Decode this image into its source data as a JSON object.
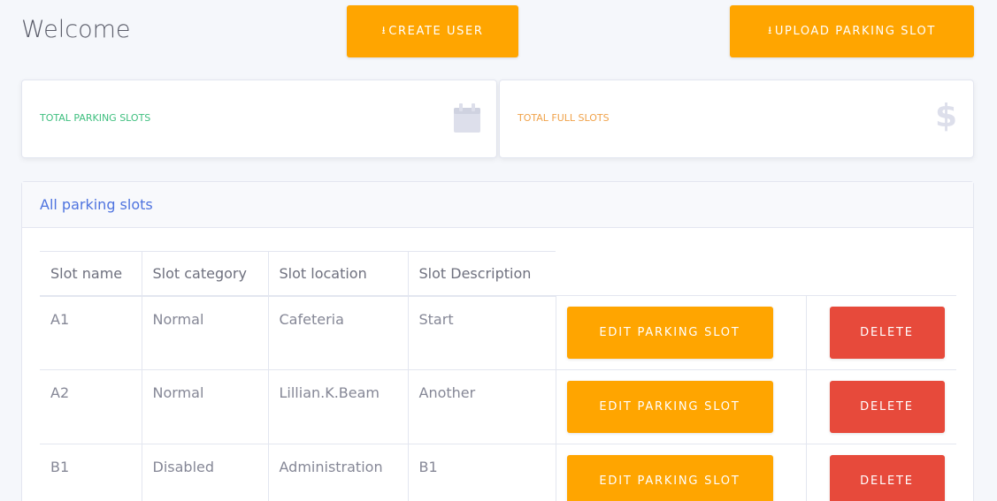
{
  "header": {
    "title": "Welcome",
    "create_user_label": "CREATE USER",
    "upload_slot_label": "UPLOAD PARKING SLOT",
    "download_icon": "download-icon"
  },
  "cards": [
    {
      "label": "TOTAL PARKING SLOTS",
      "icon": "calendar-icon",
      "color": "#3fbf7f"
    },
    {
      "label": "TOTAL FULL SLOTS",
      "icon": "dollar-icon",
      "glyph": "$",
      "color": "#f0a24a"
    }
  ],
  "panel": {
    "title": "All parking slots",
    "columns": [
      "Slot name",
      "Slot category",
      "Slot location",
      "Slot Description"
    ],
    "rows": [
      {
        "name": "A1",
        "category": "Normal",
        "location": "Cafeteria",
        "description": "Start",
        "edit_label": "EDIT PARKING SLOT",
        "delete_label": "DELETE"
      },
      {
        "name": "A2",
        "category": "Normal",
        "location": "Lillian.K.Beam",
        "description": "Another",
        "edit_label": "EDIT PARKING SLOT",
        "delete_label": "DELETE"
      },
      {
        "name": "B1",
        "category": "Disabled",
        "location": "Administration",
        "description": "B1",
        "edit_label": "EDIT PARKING SLOT",
        "delete_label": "DELETE"
      }
    ]
  },
  "colors": {
    "accent_orange": "#ffa500",
    "danger_red": "#e74a3b",
    "link_blue": "#4e73df"
  }
}
